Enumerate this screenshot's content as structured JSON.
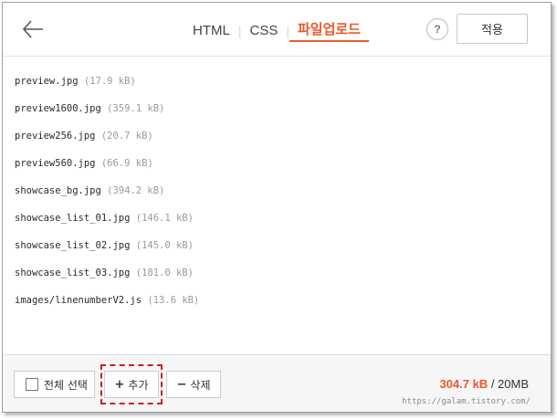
{
  "header": {
    "tabs": [
      {
        "label": "HTML",
        "active": false
      },
      {
        "label": "CSS",
        "active": false
      },
      {
        "label": "파일업로드",
        "active": true
      }
    ],
    "help_label": "?",
    "apply_label": "적용",
    "back_icon": "arrow-left-icon"
  },
  "files": [
    {
      "name": "preview.jpg",
      "size": "(17.9 kB)"
    },
    {
      "name": "preview1600.jpg",
      "size": "(359.1 kB)"
    },
    {
      "name": "preview256.jpg",
      "size": "(20.7 kB)"
    },
    {
      "name": "preview560.jpg",
      "size": "(66.9 kB)"
    },
    {
      "name": "showcase_bg.jpg",
      "size": "(394.2 kB)"
    },
    {
      "name": "showcase_list_01.jpg",
      "size": "(146.1 kB)"
    },
    {
      "name": "showcase_list_02.jpg",
      "size": "(145.0 kB)"
    },
    {
      "name": "showcase_list_03.jpg",
      "size": "(181.0 kB)"
    },
    {
      "name": "images/linenumberV2.js",
      "size": "(13.6 kB)"
    }
  ],
  "footer": {
    "select_all_label": "전체 선택",
    "add_symbol": "+",
    "add_label": "추가",
    "delete_symbol": "−",
    "delete_label": "삭제",
    "quota_used": "304.7 kB",
    "quota_total": " / 20MB",
    "watermark": "https://galam.tistory.com/"
  },
  "colors": {
    "accent": "#e85a2a",
    "highlight_border": "#cc1f1f"
  }
}
